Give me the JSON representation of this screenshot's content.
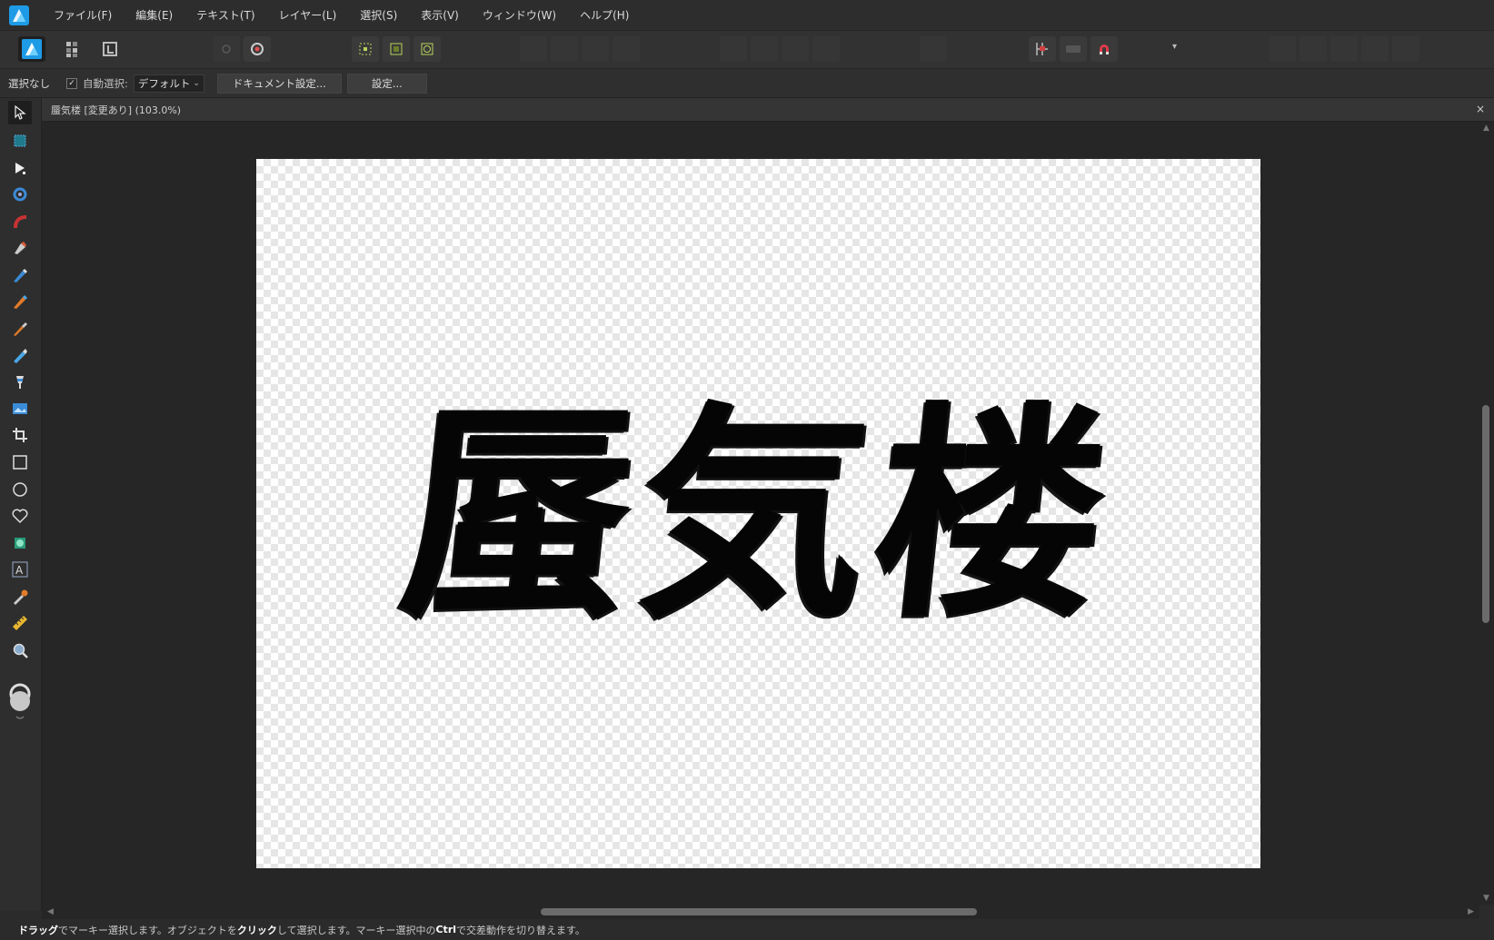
{
  "app": {
    "accent": "#1e9be6"
  },
  "menu": [
    "ファイル(F)",
    "編集(E)",
    "テキスト(T)",
    "レイヤー(L)",
    "選択(S)",
    "表示(V)",
    "ウィンドウ(W)",
    "ヘルプ(H)"
  ],
  "context_toolbar": {
    "selection": "選択なし",
    "auto_select_label": "自動選択:",
    "auto_select_checked": true,
    "auto_select_value": "デフォルト",
    "doc_settings_button": "ドキュメント設定...",
    "settings_button": "設定..."
  },
  "document": {
    "tab_title": "蜃気楼 [変更あり] (103.0%)",
    "close_glyph": "×",
    "artwork_text": "蜃気楼"
  },
  "tools": [
    "move-tool-icon",
    "artboard-tool-icon",
    "node-tool-icon",
    "corner-tool-icon",
    "point-transform-icon",
    "pen-tool-icon",
    "pencil-tool-icon",
    "vector-brush-icon",
    "paint-brush-icon",
    "fill-tool-icon",
    "transparency-tool-icon",
    "place-image-icon",
    "crop-tool-icon",
    "rectangle-tool-icon",
    "ellipse-tool-icon",
    "shape-tool-icon",
    "shape-builder-icon",
    "text-tool-icon",
    "color-picker-icon",
    "measure-tool-icon",
    "zoom-tool-icon"
  ],
  "status": {
    "p1": "ドラッグ",
    "p2": "でマーキー選択します。オブジェクトを",
    "p3": "クリック",
    "p4": "して選択します。マーキー選択中の",
    "p5": "Ctrl",
    "p6": "で交差動作を切り替えます。"
  }
}
